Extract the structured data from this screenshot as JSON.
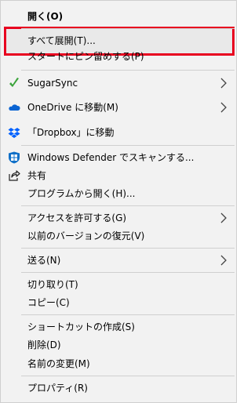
{
  "menu": {
    "items": [
      {
        "label": "開く(O)"
      },
      {
        "label": "すべて展開(T)..."
      },
      {
        "label": "スタートにピン留めする(P)"
      },
      {
        "label": "SugarSync",
        "icon": "sugarsync-icon",
        "submenu": true
      },
      {
        "label": "OneDrive に移動(M)",
        "icon": "onedrive-cloud-icon",
        "submenu": true
      },
      {
        "label": "「Dropbox」に移動",
        "icon": "dropbox-icon"
      },
      {
        "label": "Windows Defender でスキャンする...",
        "icon": "windows-defender-shield-icon"
      },
      {
        "label": "共有",
        "icon": "share-icon"
      },
      {
        "label": "プログラムから開く(H)..."
      },
      {
        "label": "アクセスを許可する(G)",
        "submenu": true
      },
      {
        "label": "以前のバージョンの復元(V)"
      },
      {
        "label": "送る(N)",
        "submenu": true
      },
      {
        "label": "切り取り(T)"
      },
      {
        "label": "コピー(C)"
      },
      {
        "label": "ショートカットの作成(S)"
      },
      {
        "label": "削除(D)"
      },
      {
        "label": "名前の変更(M)"
      },
      {
        "label": "プロパティ(R)"
      }
    ]
  },
  "colors": {
    "highlight_border": "#e8001f",
    "sugarsync_green": "#3aa33a",
    "onedrive_blue": "#0a64d2",
    "dropbox_blue": "#0061fe",
    "defender_blue": "#1070c8"
  }
}
